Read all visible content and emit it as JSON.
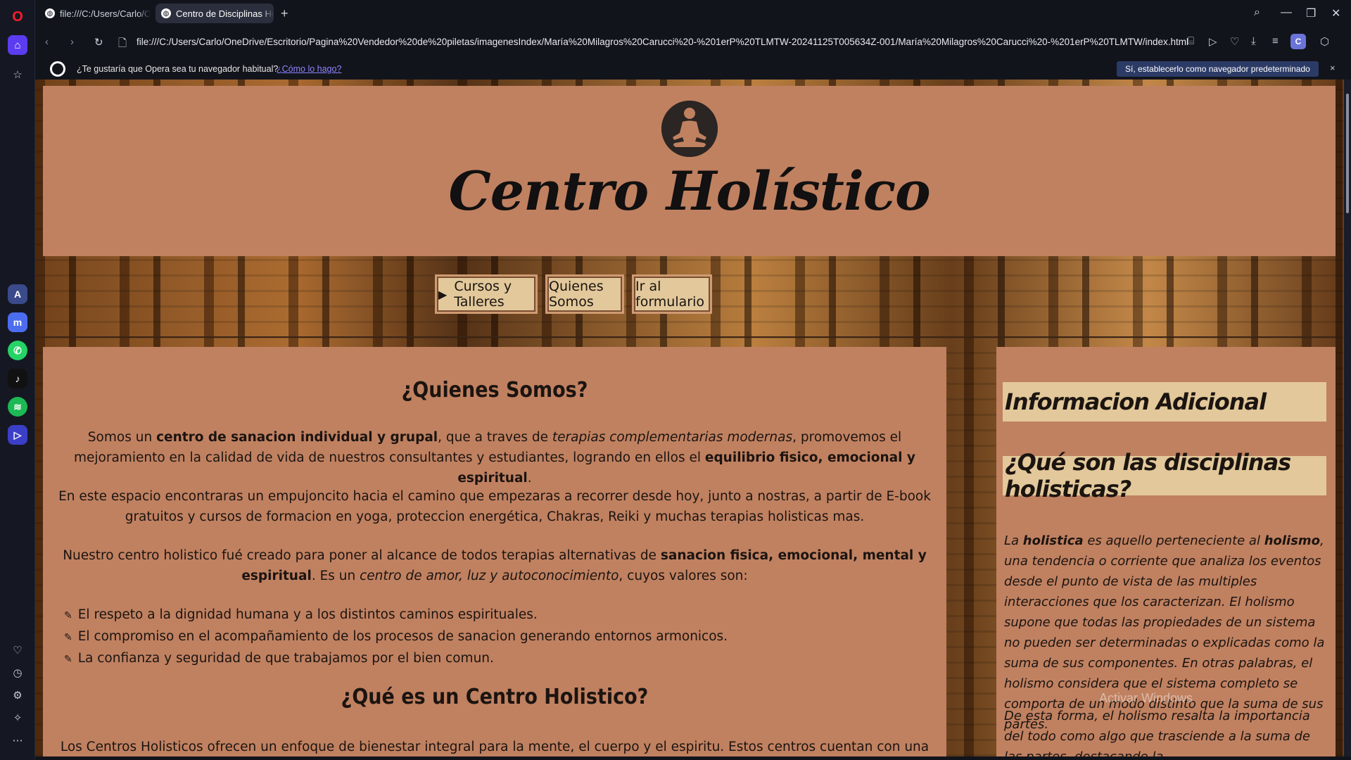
{
  "browser": {
    "tabs": [
      {
        "title": "file:///C:/Users/Carlo/OneDrive",
        "active": false
      },
      {
        "title": "Centro de Disciplinas Holísticas",
        "active": true
      }
    ],
    "new_tab_label": "+",
    "url": "file:///C:/Users/Carlo/OneDrive/Escritorio/Pagina%20Vendedor%20de%20piletas/imagenesIndex/María%20Milagros%20Carucci%20-%201erP%20TLMTW-20241125T005634Z-001/María%20Milagros%20Carucci%20-%201erP%20TLMTW/index.html",
    "profile_initial": "C",
    "infobar": {
      "question": "¿Te gustaría que Opera sea tu navegador habitual?",
      "how_link": "¿Cómo lo hago?",
      "set_default_button": "Sí, establecerlo como navegador predeterminado",
      "close": "×"
    },
    "colors": {
      "accent": "#5b3cf0",
      "infobar_button": "#2c3b66"
    }
  },
  "sidebar_apps": [
    "aria-icon",
    "messenger-icon",
    "whatsapp-icon",
    "tiktok-icon",
    "spotify-icon",
    "player-icon"
  ],
  "site": {
    "title": "Centro Holístico",
    "nav": {
      "courses": "Cursos y Talleres",
      "about": "Quienes Somos",
      "form": "Ir al formulario"
    },
    "main": {
      "about_heading": "¿Quienes Somos?",
      "p1_a": "Somos un ",
      "p1_b": "centro de sanacion individual y grupal",
      "p1_c": ", que a traves de ",
      "p1_d": "terapias complementarias modernas",
      "p1_e": ", promovemos el mejoramiento en la calidad de vida de nuestros consultantes y estudiantes, logrando en ellos el ",
      "p1_f": "equilibrio fisico, emocional y espiritual",
      "p1_g": ".",
      "p2": "En este espacio encontraras un empujoncito hacia el camino que empezaras a recorrer desde hoy, junto a nostras, a partir de E-book gratuitos y cursos de formacion en yoga, proteccion energética, Chakras, Reiki y muchas terapias holisticas mas.",
      "p3_a": "Nuestro centro holistico fué creado para poner al alcance de todos terapias alternativas de ",
      "p3_b": "sanacion fisica, emocional, mental y espiritual",
      "p3_c": ". Es un ",
      "p3_d": "centro de amor, luz y autoconocimiento",
      "p3_e": ", cuyos valores son:",
      "values": [
        "El respeto a la dignidad humana y a los distintos caminos espirituales.",
        "El compromiso en el acompañamiento de los procesos de sanacion generando entornos armonicos.",
        "La confianza y seguridad de que trabajamos por el bien comun."
      ],
      "center_heading": "¿Qué es un Centro Holistico?",
      "p4": "Los Centros Holisticos ofrecen un enfoque de bienestar integral para la mente, el cuerpo y el espiritu. Estos centros cuentan con una variedad de servicios, desde talleres"
    },
    "side": {
      "heading1": "Informacion Adicional",
      "heading2": "¿Qué son las disciplinas holisticas?",
      "s1_a": "La ",
      "s1_b": "holistica",
      "s1_c": " es aquello perteneciente al ",
      "s1_d": "holismo",
      "s1_e": ", una tendencia o corriente que analiza los eventos desde el punto de vista de las multiples interacciones que los caracterizan. El holismo supone que todas las propiedades de un sistema no pueden ser determinadas o explicadas como la suma de sus componentes. En otras palabras, el holismo considera que el sistema completo se comporta de un modo distinto que la suma de sus partes.",
      "s2": "De esta forma, el holismo resalta la importancia del todo como algo que trasciende a la suma de las partes, destacando la"
    },
    "colors": {
      "panel": "#c08161",
      "button": "#e2c89a",
      "text": "#1b1410"
    }
  },
  "watermark": "Activar Windows"
}
